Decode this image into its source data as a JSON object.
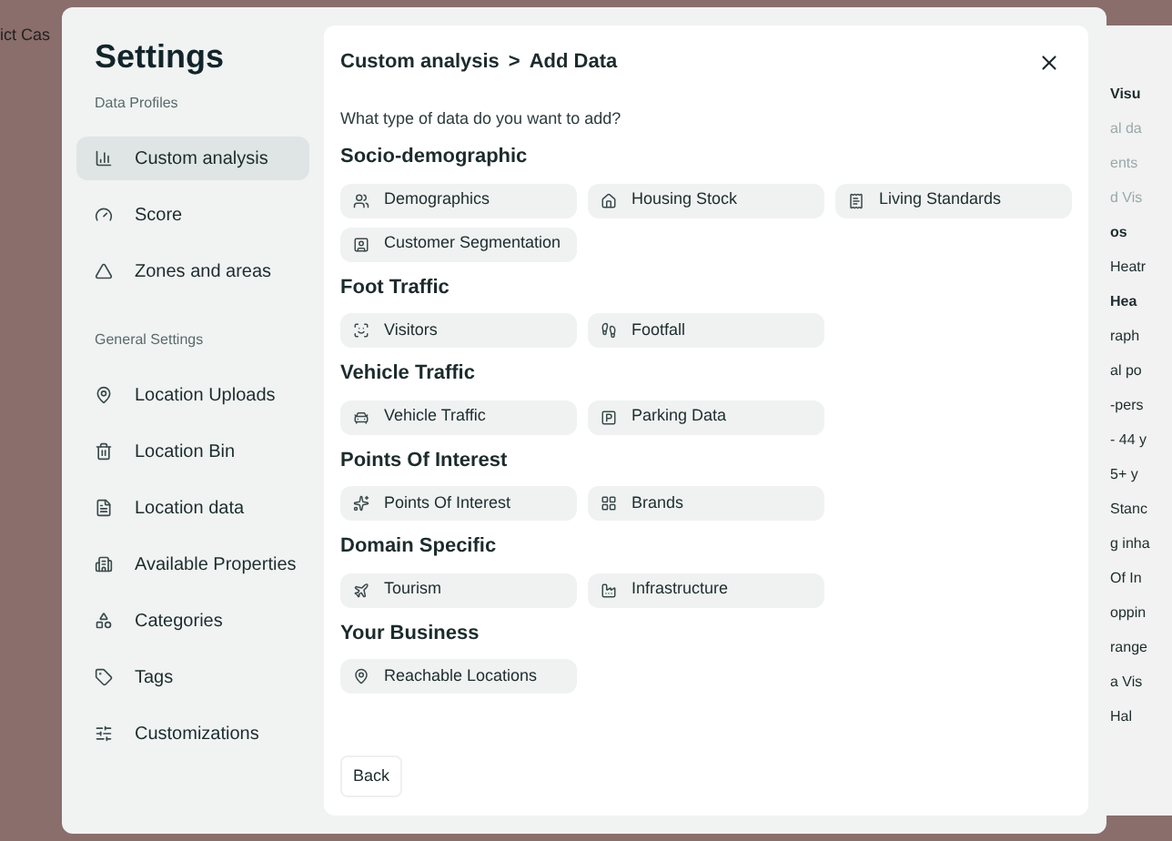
{
  "background": {
    "left_fragment": "ict Cas",
    "right_fragments": [
      {
        "text": "Visu",
        "kind": "heading"
      },
      {
        "text": "al da",
        "kind": "faded"
      },
      {
        "text": "ents",
        "kind": "faded"
      },
      {
        "text": "d Vis",
        "kind": "faded"
      },
      {
        "text": "os",
        "kind": "heading"
      },
      {
        "text": "Heatr",
        "kind": "text"
      },
      {
        "text": "Hea",
        "kind": "heading"
      },
      {
        "text": "raph",
        "kind": "text"
      },
      {
        "text": "al po",
        "kind": "text"
      },
      {
        "text": "-pers",
        "kind": "text"
      },
      {
        "text": "- 44 y",
        "kind": "text"
      },
      {
        "text": "5+ y",
        "kind": "text"
      },
      {
        "text": "Stanc",
        "kind": "text"
      },
      {
        "text": "g inha",
        "kind": "text"
      },
      {
        "text": "Of In",
        "kind": "text"
      },
      {
        "text": "oppin",
        "kind": "text"
      },
      {
        "text": "range",
        "kind": "text"
      },
      {
        "text": "a Vis",
        "kind": "text"
      },
      {
        "text": "Hal",
        "kind": "text"
      }
    ]
  },
  "sidebar": {
    "title": "Settings",
    "sections": [
      {
        "heading": "Data Profiles",
        "items": [
          {
            "label": "Custom analysis",
            "selected": true
          },
          {
            "label": "Score",
            "selected": false
          },
          {
            "label": "Zones and areas",
            "selected": false
          }
        ]
      },
      {
        "heading": "General Settings",
        "items": [
          {
            "label": "Location Uploads",
            "selected": false
          },
          {
            "label": "Location Bin",
            "selected": false
          },
          {
            "label": "Location data",
            "selected": false
          },
          {
            "label": "Available Properties",
            "selected": false
          },
          {
            "label": "Categories",
            "selected": false
          },
          {
            "label": "Tags",
            "selected": false
          },
          {
            "label": "Customizations",
            "selected": false
          }
        ]
      }
    ]
  },
  "panel": {
    "breadcrumb": [
      "Custom analysis",
      "Add Data"
    ],
    "separator": ">",
    "question": "What type of data do you want to add?",
    "groups": [
      {
        "heading": "Socio-demographic",
        "options": [
          "Demographics",
          "Housing Stock",
          "Living Standards",
          "Customer Segmentation"
        ]
      },
      {
        "heading": "Foot Traffic",
        "options": [
          "Visitors",
          "Footfall"
        ]
      },
      {
        "heading": "Vehicle Traffic",
        "options": [
          "Vehicle Traffic",
          "Parking Data"
        ]
      },
      {
        "heading": "Points Of Interest",
        "options": [
          "Points Of Interest",
          "Brands"
        ]
      },
      {
        "heading": "Domain Specific",
        "options": [
          "Tourism",
          "Infrastructure"
        ]
      },
      {
        "heading": "Your Business",
        "options": [
          "Reachable Locations"
        ]
      }
    ],
    "back": "Back"
  }
}
